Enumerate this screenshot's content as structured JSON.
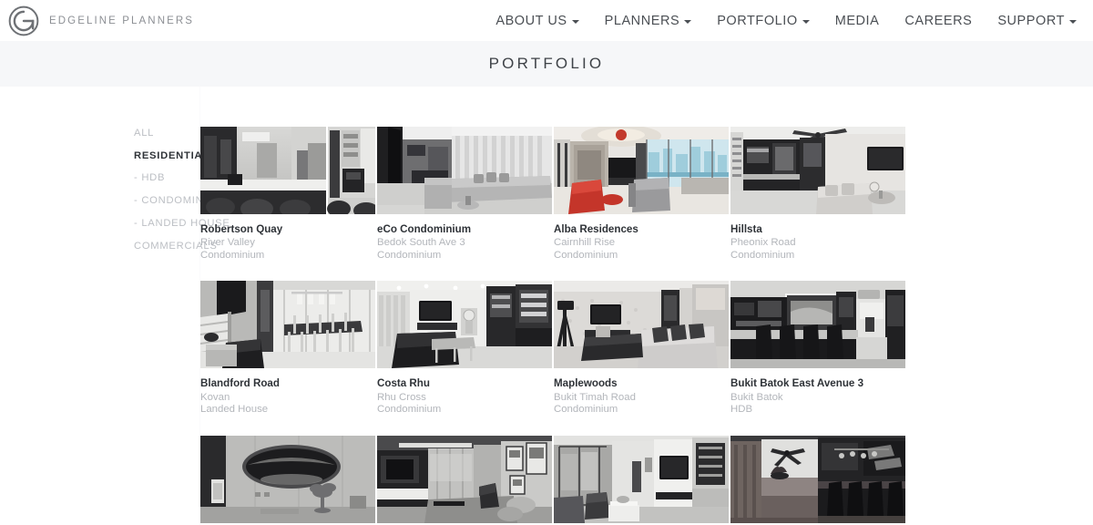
{
  "header": {
    "brand_name": "EDGELINE PLANNERS",
    "logo_icon": "edgeline-circle-e-logo",
    "nav": [
      {
        "label": "ABOUT US",
        "has_dropdown": true,
        "icon": "chevron-down-icon"
      },
      {
        "label": "PLANNERS",
        "has_dropdown": true,
        "icon": "chevron-down-icon"
      },
      {
        "label": "PORTFOLIO",
        "has_dropdown": true,
        "icon": "chevron-down-icon"
      },
      {
        "label": "MEDIA",
        "has_dropdown": false,
        "icon": ""
      },
      {
        "label": "CAREERS",
        "has_dropdown": false,
        "icon": ""
      },
      {
        "label": "SUPPORT",
        "has_dropdown": true,
        "icon": "chevron-down-icon"
      }
    ]
  },
  "page": {
    "title": "PORTFOLIO",
    "band_color": "#f6f7f9"
  },
  "sidebar": {
    "filters": [
      {
        "label": "ALL",
        "active": false
      },
      {
        "label": "RESIDENTIALS",
        "active": true
      },
      {
        "label": "- HDB",
        "active": false
      },
      {
        "label": "- CONDOMINIUM",
        "active": false
      },
      {
        "label": "- LANDED HOUSE",
        "active": false
      },
      {
        "label": "COMMERCIALS",
        "active": false
      }
    ]
  },
  "gallery": {
    "projects": [
      {
        "title": "Robertson Quay",
        "location": "River Valley",
        "type": "Condominium",
        "thumb": "kitchen-island-dark-split"
      },
      {
        "title": "eCo Condominium",
        "location": "Bedok South Ave 3",
        "type": "Condominium",
        "thumb": "living-room-grey-sofa-curtains"
      },
      {
        "title": "Alba Residences",
        "location": "Cairnhill Rise",
        "type": "Condominium",
        "thumb": "living-room-red-armchair-window"
      },
      {
        "title": "Hillsta",
        "location": "Pheonix Road",
        "type": "Condominium",
        "thumb": "living-room-ceiling-fan-tv"
      },
      {
        "title": "Blandford Road",
        "location": "Kovan",
        "type": "Landed House",
        "thumb": "stairs-dining-glass-wall"
      },
      {
        "title": "Costa Rhu",
        "location": "Rhu Cross",
        "type": "Condominium",
        "thumb": "long-living-room-tv-dark-sofa"
      },
      {
        "title": "Maplewoods",
        "location": "Bukit Timah Road",
        "type": "Condominium",
        "thumb": "living-room-tripod-camera-sofa"
      },
      {
        "title": "Bukit Batok East Avenue 3",
        "location": "Bukit Batok",
        "type": "HDB",
        "thumb": "dark-kitchen-bar-counter"
      },
      {
        "title": "",
        "location": "",
        "type": "",
        "thumb": "bedroom-oval-mirror-console"
      },
      {
        "title": "",
        "location": "",
        "type": "",
        "thumb": "living-room-tv-wall-art-frames"
      },
      {
        "title": "",
        "location": "",
        "type": "",
        "thumb": "living-room-glass-partition-tv"
      },
      {
        "title": "",
        "location": "",
        "type": "",
        "thumb": "dark-wood-kitchen-dining-fan"
      }
    ]
  },
  "colors": {
    "text_dark": "#2f3338",
    "text_muted": "#b3b6bb",
    "nav_text": "#4b4f54",
    "brand_grey": "#8c8f94",
    "page_bg": "#ffffff"
  }
}
